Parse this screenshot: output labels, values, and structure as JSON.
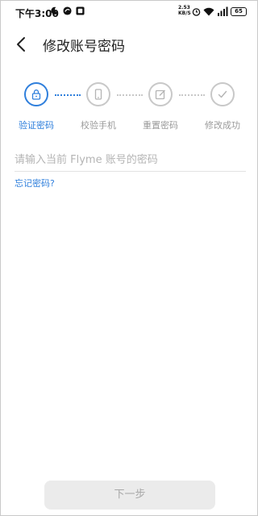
{
  "status_bar": {
    "time": "下午3:00",
    "net_speed_value": "2.53",
    "net_speed_unit": "KB/S",
    "battery": "65"
  },
  "header": {
    "title": "修改账号密码"
  },
  "stepper": {
    "steps": [
      {
        "label": "验证密码",
        "icon": "lock-icon",
        "active": true
      },
      {
        "label": "校验手机",
        "icon": "phone-icon",
        "active": false
      },
      {
        "label": "重置密码",
        "icon": "edit-icon",
        "active": false
      },
      {
        "label": "修改成功",
        "icon": "check-icon",
        "active": false
      }
    ]
  },
  "form": {
    "password_placeholder": "请输入当前 Flyme 账号的密码",
    "forgot_link": "忘记密码?"
  },
  "footer": {
    "next_label": "下一步"
  },
  "colors": {
    "accent": "#2f7fdc",
    "inactive": "#c8c8c8",
    "button_bg": "#ebebeb"
  }
}
